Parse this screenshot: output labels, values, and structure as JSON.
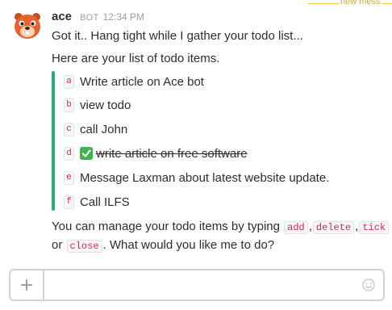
{
  "divider": {
    "new_messages_label": "new mess"
  },
  "message": {
    "username": "ace",
    "bot_badge": "BOT",
    "time": "12:34 PM",
    "avatar_icon": "beaver-avatar-icon",
    "intro": "Got it.. Hang tight while I gather your todo list...",
    "list_heading": "Here are your list of todo items.",
    "todos": [
      {
        "letter": "a",
        "text": "Write article on Ace bot",
        "done": false
      },
      {
        "letter": "b",
        "text": "view todo",
        "done": false
      },
      {
        "letter": "c",
        "text": "call John",
        "done": false
      },
      {
        "letter": "d",
        "text": "write article on free software",
        "done": true
      },
      {
        "letter": "e",
        "text": "Message Laxman about latest website update.",
        "done": false
      },
      {
        "letter": "f",
        "text": "Call ILFS",
        "done": false
      }
    ],
    "help_prefix": "You can manage your todo items by typing",
    "commands": [
      "add",
      "delete",
      "tick",
      "close"
    ],
    "help_or": "or",
    "help_suffix": ". What would you like me to do?"
  },
  "composer": {
    "plus_icon": "plus-icon",
    "emoji_icon": "smiley-icon",
    "value": ""
  },
  "colors": {
    "accent_bar": "#2bac76",
    "code_text": "#d72b3f",
    "new_messages": "#e8a23a",
    "avatar": "#e5632e"
  }
}
